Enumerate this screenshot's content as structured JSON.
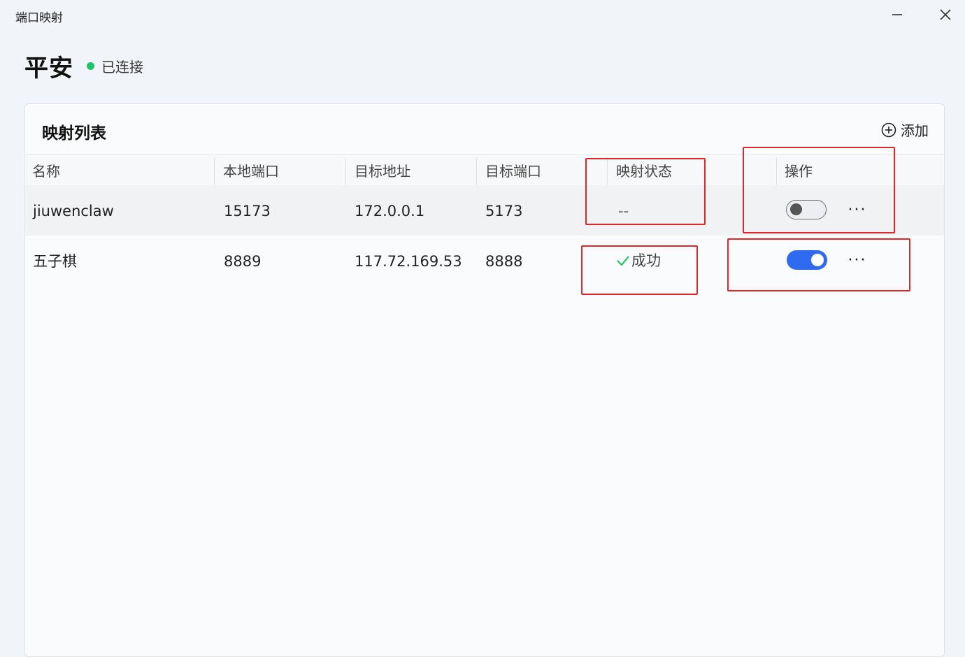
{
  "window": {
    "title": "端口映射"
  },
  "header": {
    "server_name": "平安",
    "connection_status": "已连接",
    "connection_color": "#1fc46a"
  },
  "panel": {
    "title": "映射列表",
    "add_label": "添加"
  },
  "table": {
    "columns": [
      "名称",
      "本地端口",
      "目标地址",
      "目标端口",
      "映射状态",
      "操作"
    ],
    "rows": [
      {
        "name": "jiuwenclaw",
        "local_port": "15173",
        "target_address": "172.0.0.1",
        "target_port": "5173",
        "status": "--",
        "enabled": false
      },
      {
        "name": "五子棋",
        "local_port": "8889",
        "target_address": "117.72.169.53",
        "target_port": "8888",
        "status": "成功",
        "enabled": true
      }
    ],
    "more_label": "···"
  },
  "colors": {
    "toggle_on": "#2f6bf0",
    "success_check": "#1fc46a",
    "highlight_box": "#e0262b"
  },
  "icons": {
    "minimize": "minimize-icon",
    "close": "close-icon",
    "add": "plus-circle-icon",
    "check": "check-icon"
  }
}
